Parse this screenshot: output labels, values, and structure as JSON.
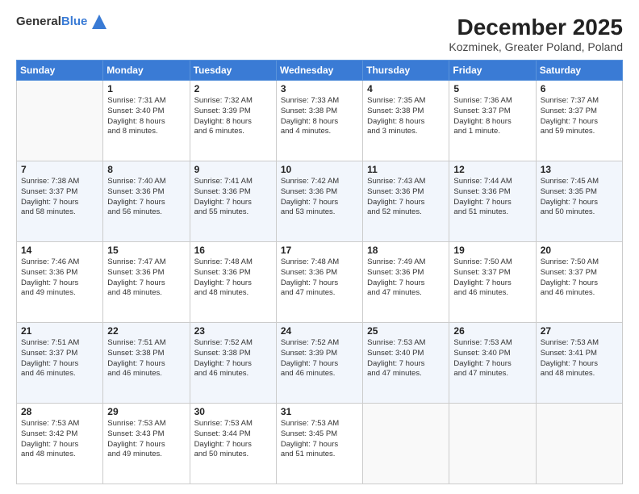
{
  "logo": {
    "general": "General",
    "blue": "Blue"
  },
  "title": "December 2025",
  "subtitle": "Kozminek, Greater Poland, Poland",
  "days_header": [
    "Sunday",
    "Monday",
    "Tuesday",
    "Wednesday",
    "Thursday",
    "Friday",
    "Saturday"
  ],
  "weeks": [
    [
      {
        "day": "",
        "info": ""
      },
      {
        "day": "1",
        "info": "Sunrise: 7:31 AM\nSunset: 3:40 PM\nDaylight: 8 hours\nand 8 minutes."
      },
      {
        "day": "2",
        "info": "Sunrise: 7:32 AM\nSunset: 3:39 PM\nDaylight: 8 hours\nand 6 minutes."
      },
      {
        "day": "3",
        "info": "Sunrise: 7:33 AM\nSunset: 3:38 PM\nDaylight: 8 hours\nand 4 minutes."
      },
      {
        "day": "4",
        "info": "Sunrise: 7:35 AM\nSunset: 3:38 PM\nDaylight: 8 hours\nand 3 minutes."
      },
      {
        "day": "5",
        "info": "Sunrise: 7:36 AM\nSunset: 3:37 PM\nDaylight: 8 hours\nand 1 minute."
      },
      {
        "day": "6",
        "info": "Sunrise: 7:37 AM\nSunset: 3:37 PM\nDaylight: 7 hours\nand 59 minutes."
      }
    ],
    [
      {
        "day": "7",
        "info": "Sunrise: 7:38 AM\nSunset: 3:37 PM\nDaylight: 7 hours\nand 58 minutes."
      },
      {
        "day": "8",
        "info": "Sunrise: 7:40 AM\nSunset: 3:36 PM\nDaylight: 7 hours\nand 56 minutes."
      },
      {
        "day": "9",
        "info": "Sunrise: 7:41 AM\nSunset: 3:36 PM\nDaylight: 7 hours\nand 55 minutes."
      },
      {
        "day": "10",
        "info": "Sunrise: 7:42 AM\nSunset: 3:36 PM\nDaylight: 7 hours\nand 53 minutes."
      },
      {
        "day": "11",
        "info": "Sunrise: 7:43 AM\nSunset: 3:36 PM\nDaylight: 7 hours\nand 52 minutes."
      },
      {
        "day": "12",
        "info": "Sunrise: 7:44 AM\nSunset: 3:36 PM\nDaylight: 7 hours\nand 51 minutes."
      },
      {
        "day": "13",
        "info": "Sunrise: 7:45 AM\nSunset: 3:35 PM\nDaylight: 7 hours\nand 50 minutes."
      }
    ],
    [
      {
        "day": "14",
        "info": "Sunrise: 7:46 AM\nSunset: 3:36 PM\nDaylight: 7 hours\nand 49 minutes."
      },
      {
        "day": "15",
        "info": "Sunrise: 7:47 AM\nSunset: 3:36 PM\nDaylight: 7 hours\nand 48 minutes."
      },
      {
        "day": "16",
        "info": "Sunrise: 7:48 AM\nSunset: 3:36 PM\nDaylight: 7 hours\nand 48 minutes."
      },
      {
        "day": "17",
        "info": "Sunrise: 7:48 AM\nSunset: 3:36 PM\nDaylight: 7 hours\nand 47 minutes."
      },
      {
        "day": "18",
        "info": "Sunrise: 7:49 AM\nSunset: 3:36 PM\nDaylight: 7 hours\nand 47 minutes."
      },
      {
        "day": "19",
        "info": "Sunrise: 7:50 AM\nSunset: 3:37 PM\nDaylight: 7 hours\nand 46 minutes."
      },
      {
        "day": "20",
        "info": "Sunrise: 7:50 AM\nSunset: 3:37 PM\nDaylight: 7 hours\nand 46 minutes."
      }
    ],
    [
      {
        "day": "21",
        "info": "Sunrise: 7:51 AM\nSunset: 3:37 PM\nDaylight: 7 hours\nand 46 minutes."
      },
      {
        "day": "22",
        "info": "Sunrise: 7:51 AM\nSunset: 3:38 PM\nDaylight: 7 hours\nand 46 minutes."
      },
      {
        "day": "23",
        "info": "Sunrise: 7:52 AM\nSunset: 3:38 PM\nDaylight: 7 hours\nand 46 minutes."
      },
      {
        "day": "24",
        "info": "Sunrise: 7:52 AM\nSunset: 3:39 PM\nDaylight: 7 hours\nand 46 minutes."
      },
      {
        "day": "25",
        "info": "Sunrise: 7:53 AM\nSunset: 3:40 PM\nDaylight: 7 hours\nand 47 minutes."
      },
      {
        "day": "26",
        "info": "Sunrise: 7:53 AM\nSunset: 3:40 PM\nDaylight: 7 hours\nand 47 minutes."
      },
      {
        "day": "27",
        "info": "Sunrise: 7:53 AM\nSunset: 3:41 PM\nDaylight: 7 hours\nand 48 minutes."
      }
    ],
    [
      {
        "day": "28",
        "info": "Sunrise: 7:53 AM\nSunset: 3:42 PM\nDaylight: 7 hours\nand 48 minutes."
      },
      {
        "day": "29",
        "info": "Sunrise: 7:53 AM\nSunset: 3:43 PM\nDaylight: 7 hours\nand 49 minutes."
      },
      {
        "day": "30",
        "info": "Sunrise: 7:53 AM\nSunset: 3:44 PM\nDaylight: 7 hours\nand 50 minutes."
      },
      {
        "day": "31",
        "info": "Sunrise: 7:53 AM\nSunset: 3:45 PM\nDaylight: 7 hours\nand 51 minutes."
      },
      {
        "day": "",
        "info": ""
      },
      {
        "day": "",
        "info": ""
      },
      {
        "day": "",
        "info": ""
      }
    ]
  ]
}
